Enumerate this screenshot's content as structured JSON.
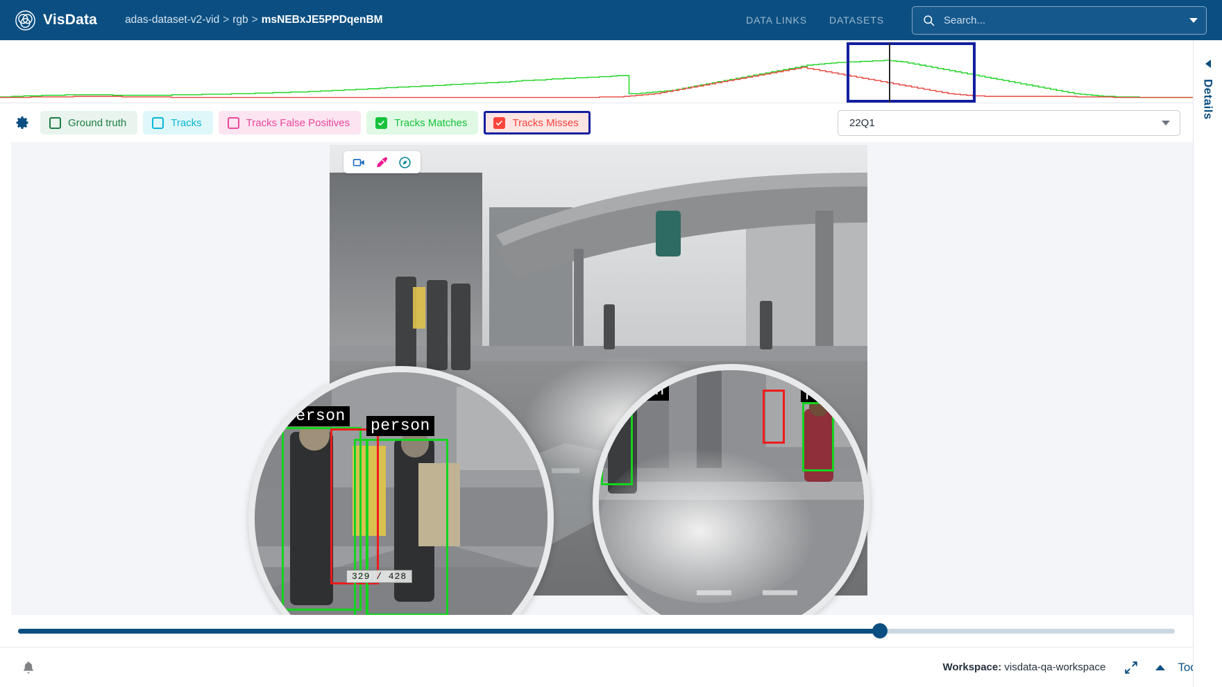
{
  "header": {
    "brand": "VisData",
    "logo_icon": "venn-circles-icon",
    "breadcrumb": {
      "parts": [
        "adas-dataset-v2-vid",
        "rgb",
        "msNEBxJE5PPDqenBM"
      ],
      "separator": ">"
    },
    "nav": [
      {
        "label": "DATA LINKS",
        "name": "nav-data-links"
      },
      {
        "label": "DATASETS",
        "name": "nav-datasets"
      }
    ],
    "search": {
      "placeholder": "Search...",
      "value": "",
      "icon": "search-icon",
      "caret": "chevron-down-icon"
    }
  },
  "timeline": {
    "name": "timeline-overview-chart",
    "selection": {
      "start_pct": 71.0,
      "end_pct": 81.8
    },
    "playhead_pct": 74.5
  },
  "filters": {
    "gear_icon": "gear-icon",
    "chips": [
      {
        "label": "Ground truth",
        "checked": false,
        "color": "#1e7c45",
        "bg": "#e8f4ed",
        "cls": "chip-gt",
        "name": "filter-chip-ground-truth",
        "highlight": false
      },
      {
        "label": "Tracks",
        "checked": false,
        "color": "#06b6d4",
        "bg": "#e0f7fa",
        "cls": "chip-tracks",
        "name": "filter-chip-tracks",
        "highlight": false
      },
      {
        "label": "Tracks False Positives",
        "checked": false,
        "color": "#ec4899",
        "bg": "#fce4f1",
        "cls": "chip-fp",
        "name": "filter-chip-tracks-false-positives",
        "highlight": false
      },
      {
        "label": "Tracks Matches",
        "checked": true,
        "color": "#15c23b",
        "bg": "#e0f9e4",
        "cls": "chip-match",
        "name": "filter-chip-tracks-matches",
        "highlight": false
      },
      {
        "label": "Tracks Misses",
        "checked": true,
        "color": "#f8443a",
        "bg": "#fde5e3",
        "cls": "chip-miss",
        "name": "filter-chip-tracks-misses",
        "highlight": true
      }
    ],
    "quarter_select": {
      "value": "22Q1",
      "caret": "chevron-down-icon"
    }
  },
  "viewer": {
    "tools": [
      {
        "icon": "video-camera-icon",
        "color": "#1565c0",
        "name": "video-camera-tool"
      },
      {
        "icon": "eyedropper-icon",
        "color": "#e91e8c",
        "name": "eyedropper-tool"
      },
      {
        "icon": "compass-icon",
        "color": "#00838f",
        "name": "compass-tool"
      }
    ],
    "frame_counter": "329  /  428",
    "frame_current": 329,
    "frame_total": 428,
    "annotations": [
      {
        "label": "person",
        "box": "green",
        "name": "annotation-person-1"
      },
      {
        "label": "person",
        "box": "green",
        "name": "annotation-person-2"
      },
      {
        "label": "person",
        "box": "green",
        "name": "annotation-person-3"
      },
      {
        "label": "person",
        "box": "green",
        "name": "annotation-person-4"
      }
    ],
    "magnifiers": [
      {
        "name": "magnifier-left"
      },
      {
        "name": "magnifier-right"
      }
    ]
  },
  "scrubber": {
    "value_pct": 74.5,
    "name": "frame-scrubber"
  },
  "footer": {
    "bell_icon": "bell-icon",
    "workspace_label": "Workspace:",
    "workspace_value": "visdata-qa-workspace",
    "expand_icon": "expand-arrows-icon",
    "chevron_icon": "chevron-up-icon",
    "tools_label": "Tools"
  },
  "details_panel": {
    "label": "Details",
    "chevron": "chevron-left-icon"
  },
  "colors": {
    "brand_blue": "#0b4f82",
    "highlight_navy": "#131f9e",
    "match_green": "#15c23b",
    "miss_red": "#f8443a",
    "track_cyan": "#06b6d4",
    "fp_pink": "#ec4899",
    "gt_green": "#1e7c45"
  },
  "chart_data": {
    "type": "line",
    "title": "",
    "xlabel": "",
    "ylabel": "",
    "grid": false,
    "legend": "none",
    "series": [
      {
        "name": "matches",
        "color": "#19d21f",
        "values": [
          4,
          4,
          5,
          5,
          6,
          6,
          6,
          7,
          7,
          7,
          7,
          8,
          8,
          8,
          8,
          8,
          8,
          8,
          8,
          7,
          7,
          7,
          7,
          7,
          7,
          7,
          7,
          7,
          7,
          8,
          8,
          8,
          8,
          8,
          9,
          9,
          9,
          9,
          9,
          10,
          10,
          10,
          10,
          11,
          11,
          11,
          12,
          12,
          12,
          13,
          13,
          13,
          14,
          14,
          15,
          15,
          16,
          16,
          17,
          17,
          18,
          18,
          19,
          19,
          20,
          21,
          21,
          22,
          22,
          23,
          23,
          24,
          24,
          25,
          25,
          26,
          27,
          27,
          28,
          28,
          29,
          29,
          30,
          30,
          31,
          31,
          32,
          33,
          34,
          34,
          35,
          35,
          36,
          37,
          37,
          38,
          38,
          39,
          39,
          40,
          40,
          41,
          41,
          42,
          43,
          43,
          10,
          10,
          11,
          12,
          13,
          14,
          15,
          16,
          18,
          20,
          22,
          24,
          26,
          28,
          30,
          32,
          34,
          36,
          38,
          40,
          42,
          44,
          46,
          48,
          50,
          52,
          54,
          56,
          58,
          60,
          62,
          63,
          64,
          65,
          66,
          67,
          67,
          68,
          68,
          69,
          69,
          70,
          70,
          71,
          70,
          69,
          68,
          66,
          64,
          62,
          60,
          58,
          56,
          54,
          52,
          50,
          48,
          46,
          44,
          42,
          40,
          38,
          36,
          34,
          32,
          30,
          28,
          26,
          24,
          22,
          20,
          18,
          16,
          14,
          12,
          10,
          9,
          8,
          7,
          6,
          5,
          5,
          4,
          4,
          4,
          4,
          3,
          3,
          3,
          3,
          3,
          3,
          3,
          3,
          3,
          3
        ]
      },
      {
        "name": "misses",
        "color": "#e8443c",
        "values": [
          3,
          3,
          3,
          3,
          3,
          4,
          4,
          4,
          4,
          4,
          4,
          4,
          5,
          5,
          5,
          5,
          5,
          5,
          5,
          5,
          4,
          4,
          4,
          4,
          4,
          4,
          4,
          4,
          3,
          3,
          3,
          3,
          3,
          3,
          3,
          3,
          3,
          3,
          3,
          3,
          3,
          3,
          3,
          3,
          3,
          3,
          3,
          3,
          3,
          3,
          3,
          3,
          3,
          3,
          3,
          3,
          3,
          3,
          3,
          3,
          3,
          3,
          3,
          3,
          3,
          3,
          3,
          3,
          3,
          3,
          3,
          3,
          3,
          3,
          3,
          3,
          3,
          3,
          3,
          3,
          3,
          3,
          3,
          3,
          3,
          3,
          3,
          3,
          3,
          3,
          3,
          3,
          3,
          3,
          3,
          3,
          3,
          3,
          4,
          4,
          4,
          4,
          5,
          6,
          7,
          8,
          9,
          10,
          12,
          14,
          16,
          18,
          20,
          22,
          24,
          26,
          28,
          30,
          32,
          34,
          36,
          38,
          40,
          42,
          44,
          46,
          48,
          50,
          52,
          54,
          56,
          58,
          56,
          54,
          52,
          50,
          48,
          46,
          44,
          42,
          40,
          38,
          36,
          34,
          32,
          30,
          28,
          26,
          24,
          22,
          20,
          18,
          16,
          14,
          12,
          10,
          9,
          8,
          7,
          6,
          6,
          5,
          5,
          5,
          5,
          5,
          5,
          5,
          5,
          5,
          5,
          5,
          5,
          5,
          5,
          5,
          4,
          4,
          4,
          4,
          4,
          4,
          3,
          3,
          3,
          3,
          3,
          3,
          3,
          3,
          3,
          3,
          3,
          3,
          3,
          3
        ]
      }
    ],
    "xlim": [
      0,
      200
    ],
    "ylim": [
      0,
      100
    ]
  }
}
